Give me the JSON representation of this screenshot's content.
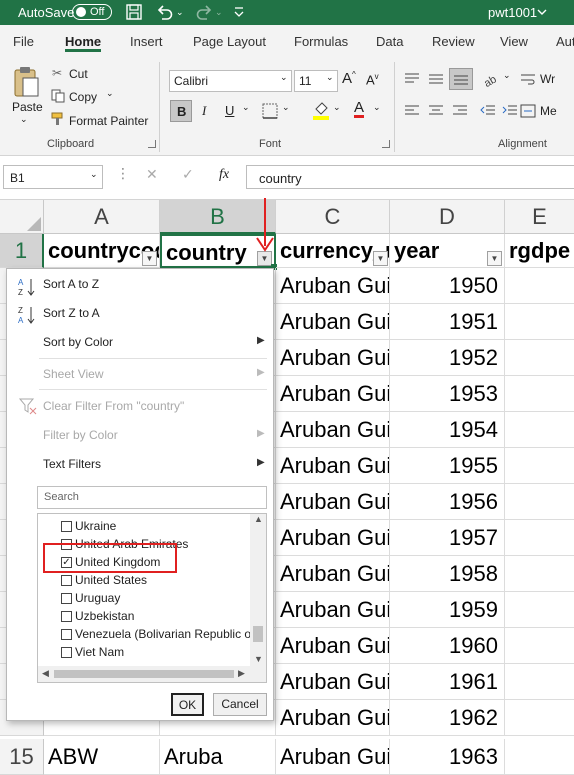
{
  "titlebar": {
    "autosave": "AutoSave",
    "autosave_state": "Off",
    "filename": "pwt1001"
  },
  "tabs": [
    "File",
    "Home",
    "Insert",
    "Page Layout",
    "Formulas",
    "Data",
    "Review",
    "View",
    "Aut"
  ],
  "ribbon": {
    "paste": "Paste",
    "cut": "Cut",
    "copy": "Copy",
    "format_painter": "Format Painter",
    "clipboard_group": "Clipboard",
    "font_name": "Calibri",
    "font_size": "11",
    "font_group": "Font",
    "alignment_group": "Alignment",
    "wrap_partial": "Wr",
    "merge_partial": "Me",
    "bold": "B",
    "italic": "I",
    "underline": "U"
  },
  "formula_bar": {
    "name_box": "B1",
    "fx": "fx",
    "content": "country"
  },
  "columns": [
    "A",
    "B",
    "C",
    "D",
    "E"
  ],
  "header_row": {
    "row_number": "1",
    "cells": [
      "countrycode",
      "country",
      "currency_unit",
      "year",
      "rgdpe"
    ]
  },
  "rows": [
    {
      "currency": "Aruban Guilder",
      "year": "1950"
    },
    {
      "currency": "Aruban Guilder",
      "year": "1951"
    },
    {
      "currency": "Aruban Guilder",
      "year": "1952"
    },
    {
      "currency": "Aruban Guilder",
      "year": "1953"
    },
    {
      "currency": "Aruban Guilder",
      "year": "1954"
    },
    {
      "currency": "Aruban Guilder",
      "year": "1955"
    },
    {
      "currency": "Aruban Guilder",
      "year": "1956"
    },
    {
      "currency": "Aruban Guilder",
      "year": "1957"
    },
    {
      "currency": "Aruban Guilder",
      "year": "1958"
    },
    {
      "currency": "Aruban Guilder",
      "year": "1959"
    },
    {
      "currency": "Aruban Guilder",
      "year": "1960"
    },
    {
      "currency": "Aruban Guilder",
      "year": "1961"
    },
    {
      "currency": "Aruban Guilder",
      "year": "1962"
    }
  ],
  "last_row": {
    "row_number": "15",
    "countrycode": "ABW",
    "country": "Aruba",
    "currency": "Aruban Guilder",
    "year": "1963"
  },
  "filter_menu": {
    "sort_az": "Sort A to Z",
    "sort_za": "Sort Z to A",
    "sort_color": "Sort by Color",
    "sheet_view": "Sheet View",
    "clear_filter": "Clear Filter From \"country\"",
    "filter_color": "Filter by Color",
    "text_filters": "Text Filters",
    "search_placeholder": "Search",
    "list": [
      {
        "label": "Ukraine",
        "checked": false
      },
      {
        "label": "United Arab Emirates",
        "checked": false
      },
      {
        "label": "United Kingdom",
        "checked": true
      },
      {
        "label": "United States",
        "checked": false
      },
      {
        "label": "Uruguay",
        "checked": false
      },
      {
        "label": "Uzbekistan",
        "checked": false
      },
      {
        "label": "Venezuela (Bolivarian Republic of)",
        "checked": false
      },
      {
        "label": "Viet Nam",
        "checked": false
      }
    ],
    "ok": "OK",
    "cancel": "Cancel"
  },
  "colors": {
    "excel_green": "#217346",
    "annotation_red": "#e02020"
  }
}
